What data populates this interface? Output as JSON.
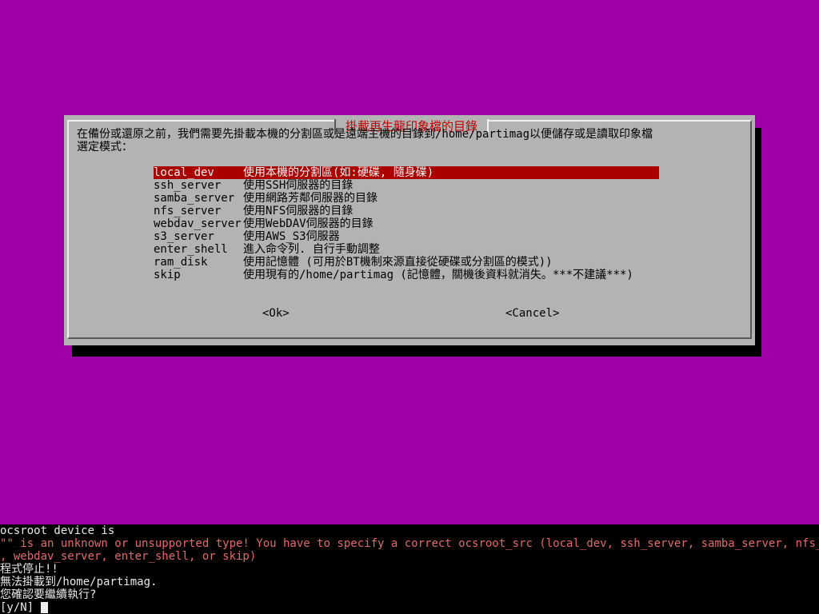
{
  "dialog": {
    "title": "掛載再生龍印象檔的目錄",
    "prompt_line1": "在備份或還原之前，我們需要先掛載本機的分割區或是遠端主機的目錄到/home/partimag以便儲存或是讀取印象檔",
    "prompt_line2": "選定模式：",
    "items": [
      {
        "key": "local_dev",
        "desc": "使用本機的分割區(如:硬碟, 隨身碟)"
      },
      {
        "key": "ssh_server",
        "desc": "使用SSH伺服器的目錄"
      },
      {
        "key": "samba_server",
        "desc": "使用網路芳鄰伺服器的目錄"
      },
      {
        "key": "nfs_server",
        "desc": "使用NFS伺服器的目錄"
      },
      {
        "key": "webdav_server",
        "desc": "使用WebDAV伺服器的目錄"
      },
      {
        "key": "s3_server",
        "desc": "使用AWS_S3伺服器"
      },
      {
        "key": "enter_shell",
        "desc": "進入命令列. 自行手動調整"
      },
      {
        "key": "ram_disk",
        "desc": "使用記憶體 (可用於BT機制來源直接從硬碟或分割區的模式))"
      },
      {
        "key": "skip",
        "desc": "使用現有的/home/partimag (記憶體，關機後資料就消失。***不建議***)"
      }
    ],
    "ok_label": "<Ok>",
    "cancel_label": "<Cancel>"
  },
  "terminal": {
    "line1": "ocsroot device is",
    "line2": "\"\" is an unknown or unsupported type! You have to specify a correct ocsroot_src (local_dev, ssh_server, samba_server, nfs_server",
    "line3": ", webdav_server, enter_shell, or skip)",
    "line4": "程式停止!!",
    "line5": "無法掛載到/home/partimag.",
    "line6": "您確認要繼續執行?",
    "line7": "[y/N] "
  },
  "colors": {
    "background": "#a000a8",
    "dialog": "#b3b3b3",
    "selection": "#aa0000",
    "title": "#c00000",
    "terminal_error": "#e06a6a"
  }
}
